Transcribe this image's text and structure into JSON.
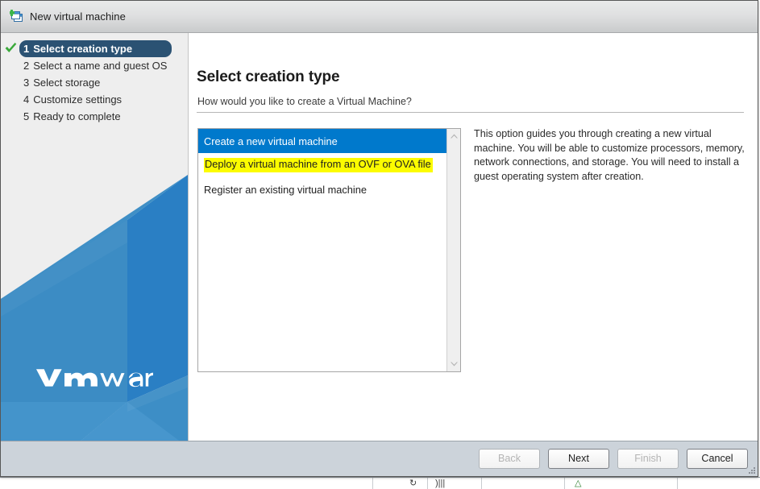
{
  "window": {
    "title": "New virtual machine",
    "icon": "new-virtual-machine-icon"
  },
  "sidebar": {
    "brand": "vmware",
    "brand_trademark": "®",
    "steps": [
      {
        "num": "1",
        "label": "Select creation type",
        "state": "active-complete"
      },
      {
        "num": "2",
        "label": "Select a name and guest OS",
        "state": "pending"
      },
      {
        "num": "3",
        "label": "Select storage",
        "state": "pending"
      },
      {
        "num": "4",
        "label": "Customize settings",
        "state": "pending"
      },
      {
        "num": "5",
        "label": "Ready to complete",
        "state": "pending"
      }
    ]
  },
  "content": {
    "title": "Select creation type",
    "subtitle": "How would you like to create a Virtual Machine?",
    "options": [
      {
        "label": "Create a new virtual machine",
        "selected": true,
        "highlighted": false
      },
      {
        "label": "Deploy a virtual machine from an OVF or OVA file",
        "selected": false,
        "highlighted": true
      },
      {
        "label": "Register an existing virtual machine",
        "selected": false,
        "highlighted": false
      }
    ],
    "description": "This option guides you through creating a new virtual machine. You will be able to customize processors, memory, network connections, and storage. You will need to install a guest operating system after creation.",
    "scrollbar": {
      "up_icon": "chevron-up-icon",
      "down_icon": "chevron-down-icon"
    }
  },
  "footer": {
    "buttons": [
      {
        "label": "Back",
        "enabled": false
      },
      {
        "label": "Next",
        "enabled": true
      },
      {
        "label": "Finish",
        "enabled": false
      },
      {
        "label": "Cancel",
        "enabled": true
      }
    ]
  },
  "colors": {
    "accent_blue": "#0079cc",
    "sidebar_navy": "#2b5273",
    "highlight_yellow": "#fcfc00",
    "check_green": "#3aa93a",
    "footer_gray": "#ccd3da"
  }
}
